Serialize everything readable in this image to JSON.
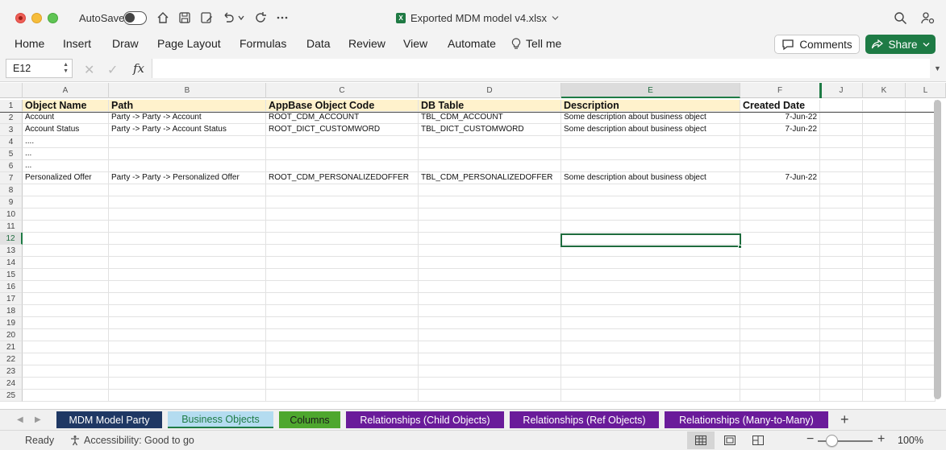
{
  "titlebar": {
    "autosave_label": "AutoSave",
    "doc_title": "Exported MDM model v4.xlsx",
    "excel_badge": "X"
  },
  "ribbon": {
    "tabs": [
      "Home",
      "Insert",
      "Draw",
      "Page Layout",
      "Formulas",
      "Data",
      "Review",
      "View",
      "Automate",
      "Tell me"
    ],
    "comments_label": "Comments",
    "share_label": "Share"
  },
  "formula_bar": {
    "namebox": "E12",
    "fx": "fx",
    "content": ""
  },
  "grid": {
    "columns": [
      "A",
      "B",
      "C",
      "D",
      "E",
      "F",
      "J",
      "K",
      "L"
    ],
    "active_column": "E",
    "active_row": "12",
    "row_numbers": [
      "1",
      "2",
      "3",
      "4",
      "5",
      "6",
      "7",
      "8",
      "9",
      "10",
      "11",
      "12",
      "13",
      "14",
      "15",
      "16",
      "17",
      "18",
      "19",
      "20",
      "21",
      "22",
      "23",
      "24",
      "25"
    ],
    "header_row": [
      "Object Name",
      "Path",
      "AppBase Object Code",
      "DB Table",
      "Description",
      "Created Date"
    ],
    "rows": [
      [
        "Account",
        "Party -> Party -> Account",
        "ROOT_CDM_ACCOUNT",
        "TBL_CDM_ACCOUNT",
        "Some description about business object",
        "7-Jun-22"
      ],
      [
        "Account Status",
        "Party -> Party -> Account Status",
        "ROOT_DICT_CUSTOMWORD",
        "TBL_DICT_CUSTOMWORD",
        "Some description about business object",
        "7-Jun-22"
      ],
      [
        "....",
        "",
        "",
        "",
        "",
        ""
      ],
      [
        "...",
        "",
        "",
        "",
        "",
        ""
      ],
      [
        "...",
        "",
        "",
        "",
        "",
        ""
      ],
      [
        "Personalized Offer",
        "Party -> Party -> Personalized Offer",
        "ROOT_CDM_PERSONALIZEDOFFER",
        "TBL_CDM_PERSONALIZEDOFFER",
        "Some description about business object",
        "7-Jun-22"
      ]
    ]
  },
  "sheets": [
    {
      "label": "MDM Model Party",
      "color": "#1f3864",
      "text": "#ffffff"
    },
    {
      "label": "Business Objects",
      "color": "#b4dcf0",
      "text": "#1e7b45",
      "active": true
    },
    {
      "label": "Columns",
      "color": "#4ea72e",
      "text": "#1b1b1b"
    },
    {
      "label": "Relationships (Child Objects)",
      "color": "#6a1b9a",
      "text": "#ffffff"
    },
    {
      "label": "Relationships (Ref Objects)",
      "color": "#6a1b9a",
      "text": "#ffffff"
    },
    {
      "label": "Relationships (Many-to-Many)",
      "color": "#6a1b9a",
      "text": "#ffffff"
    }
  ],
  "statusbar": {
    "ready": "Ready",
    "accessibility": "Accessibility: Good to go",
    "zoom": "100%"
  },
  "colors": {
    "accent": "#1e7b45",
    "header_highlight": "#fff2cc"
  }
}
